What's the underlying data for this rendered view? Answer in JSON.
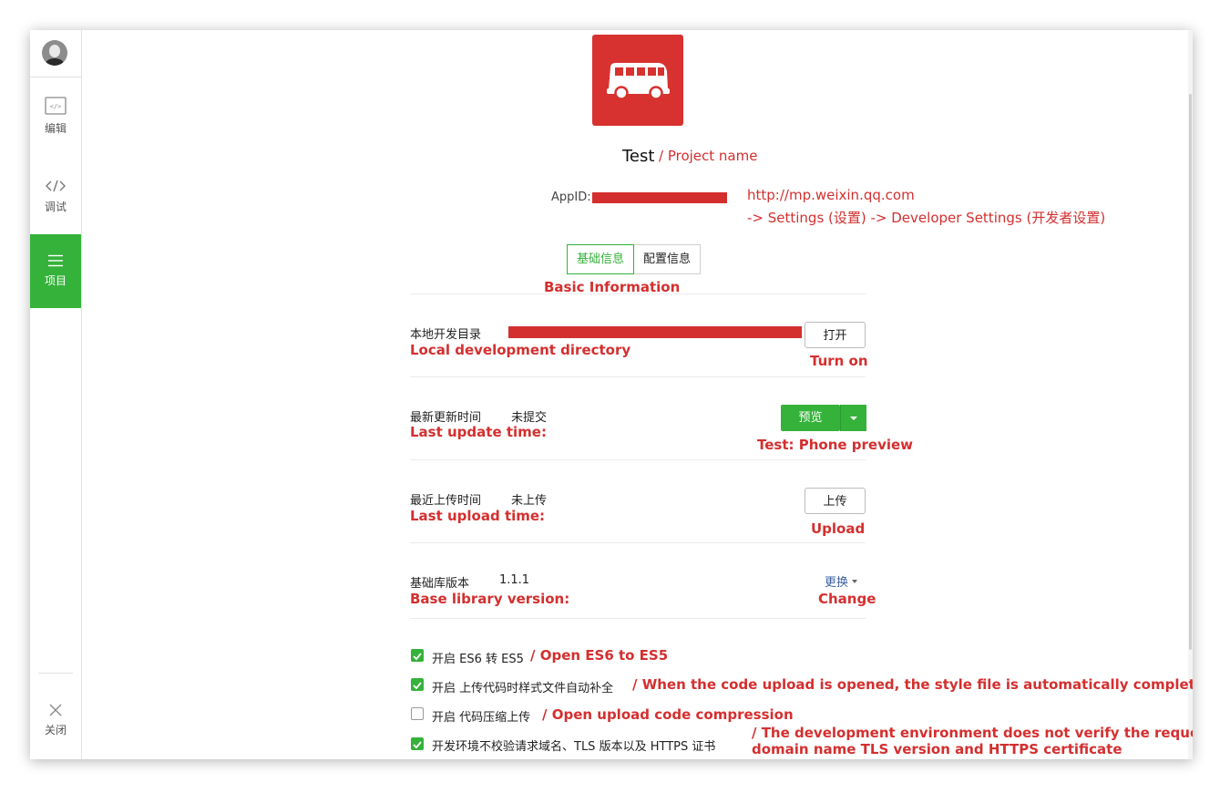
{
  "sidebar": {
    "items": [
      {
        "label": "编辑",
        "icon": "editor-icon"
      },
      {
        "label": "调试",
        "icon": "debug-code-icon"
      },
      {
        "label": "项目",
        "icon": "project-menu-icon"
      }
    ],
    "close_label": "关闭"
  },
  "project": {
    "name": "Test",
    "name_annotation": "/ Project name",
    "appid_label": "AppID:",
    "appid_hint_url": "http://mp.weixin.qq.com",
    "appid_hint_path": "-> Settings (设置) -> Developer Settings (开发者设置)"
  },
  "tabs": [
    {
      "label": "基础信息",
      "active": true
    },
    {
      "label": "配置信息",
      "active": false
    }
  ],
  "tab_annotation": "Basic Information",
  "rows": {
    "local_dir": {
      "label": "本地开发目录",
      "annotation": "Local development directory",
      "button": "打开",
      "button_annotation": "Turn on"
    },
    "last_update": {
      "label": "最新更新时间",
      "value": "未提交",
      "annotation": "Last update time:",
      "button": "预览",
      "button_annotation": "Test: Phone preview"
    },
    "last_upload": {
      "label": "最近上传时间",
      "value": "未上传",
      "annotation": "Last upload time:",
      "button": "上传",
      "button_annotation": "Upload"
    },
    "base_lib": {
      "label": "基础库版本",
      "value": "1.1.1",
      "annotation": "Base library version:",
      "link": "更换",
      "link_annotation": "Change"
    }
  },
  "options": [
    {
      "label": "开启 ES6 转 ES5",
      "checked": true,
      "annotation": "/ Open ES6 to ES5"
    },
    {
      "label": "开启 上传代码时样式文件自动补全",
      "checked": true,
      "annotation": "/ When the code upload is opened, the style file is automatically completed"
    },
    {
      "label": "开启 代码压缩上传",
      "checked": false,
      "annotation": "/ Open upload code compression"
    },
    {
      "label": "开发环境不校验请求域名、TLS 版本以及 HTTPS 证书",
      "checked": true,
      "annotation_line1": "/ The development environment does not verify the request",
      "annotation_line2": "domain name TLS version and HTTPS certificate"
    }
  ],
  "colors": {
    "accent_green": "#35b23a",
    "annotation_red": "#d42f2f",
    "app_icon_bg": "#d73230"
  }
}
